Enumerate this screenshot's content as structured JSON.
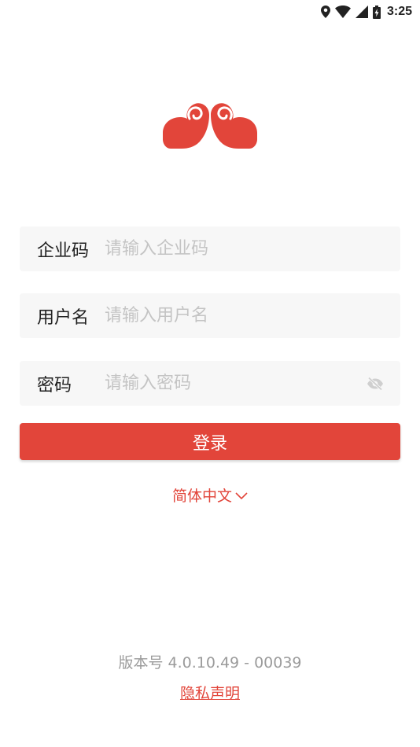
{
  "status_bar": {
    "time": "3:25",
    "icons": [
      "location-icon",
      "wifi-icon",
      "signal-icon",
      "battery-charging-icon"
    ]
  },
  "logo": {
    "icon": "auspicious-cloud-logo",
    "color": "#e2453a"
  },
  "form": {
    "company_code": {
      "label": "企业码",
      "placeholder": "请输入企业码",
      "value": ""
    },
    "username": {
      "label": "用户名",
      "placeholder": "请输入用户名",
      "value": ""
    },
    "password": {
      "label": "密码",
      "placeholder": "请输入密码",
      "value": "",
      "visibility_icon": "eye-off-icon"
    }
  },
  "login_button": {
    "label": "登录",
    "color": "#e2453a"
  },
  "language": {
    "selected": "简体中文",
    "icon": "chevron-down-icon"
  },
  "footer": {
    "version": "版本号 4.0.10.49 - 00039",
    "privacy_link": "隐私声明"
  }
}
